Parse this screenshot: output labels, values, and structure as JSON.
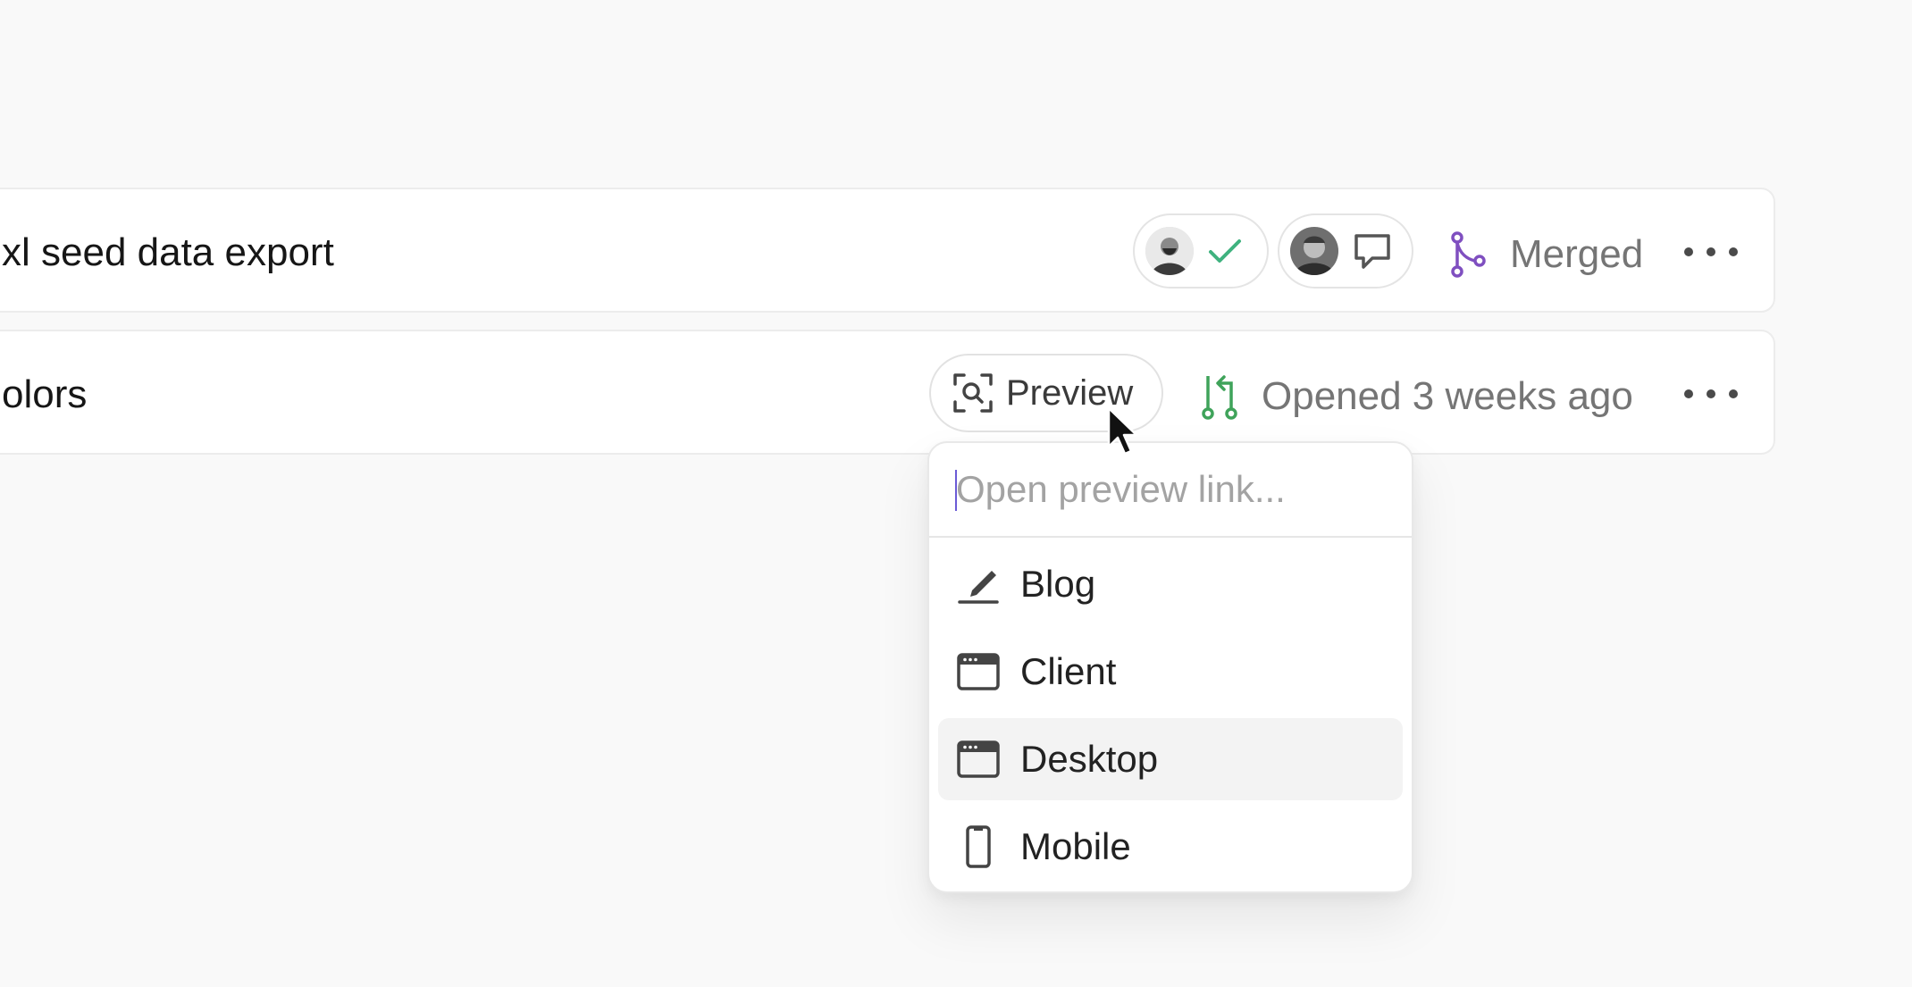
{
  "rows": [
    {
      "title": "xl seed data export",
      "status_label": "Merged",
      "status_icon": "merge-icon",
      "status_color": "#7f4fc0",
      "reviewers": [
        {
          "avatar": "avatar",
          "state_icon": "check-icon",
          "state_color": "#3fb27f"
        },
        {
          "avatar": "avatar",
          "state_icon": "comment-icon",
          "state_color": "#555555"
        }
      ]
    },
    {
      "title": "olors",
      "preview_label": "Preview",
      "preview_icon": "preview-search-icon",
      "status_label": "Opened 3 weeks ago",
      "status_icon": "pull-request-icon",
      "status_color": "#3fa35a"
    }
  ],
  "dropdown": {
    "search_placeholder": "Open preview link...",
    "search_value": "",
    "items": [
      {
        "label": "Blog",
        "icon": "pencil-icon"
      },
      {
        "label": "Client",
        "icon": "browser-window-icon"
      },
      {
        "label": "Desktop",
        "icon": "browser-window-icon",
        "active": true
      },
      {
        "label": "Mobile",
        "icon": "mobile-phone-icon"
      }
    ]
  },
  "more_icon": "more-horizontal-icon"
}
